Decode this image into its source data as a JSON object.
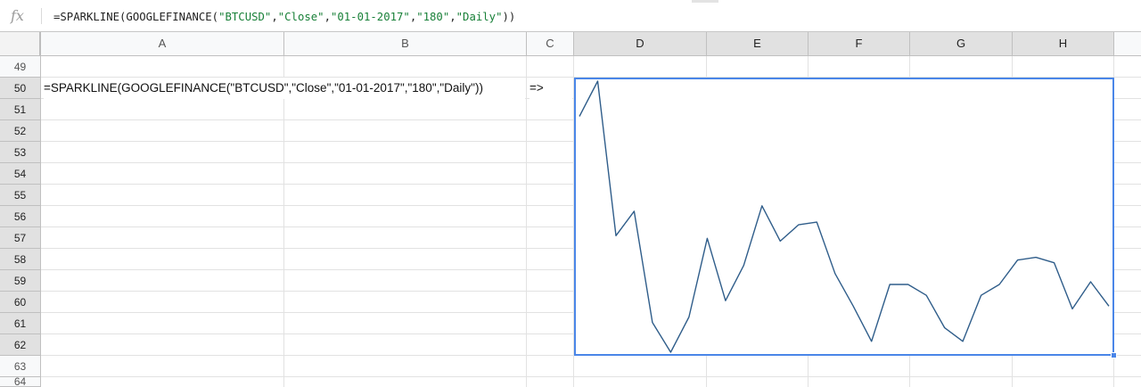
{
  "formula_bar": {
    "icon": "fx-icon",
    "parts": {
      "p1": "=SPARKLINE(GOOGLEFINANCE(",
      "s1": "\"BTCUSD\"",
      "c1": ",",
      "s2": "\"Close\"",
      "c2": ",",
      "s3": "\"01-01-2017\"",
      "c3": ",",
      "s4": "\"180\"",
      "c4": ",",
      "s5": "\"Daily\"",
      "p2": "))"
    }
  },
  "columns": [
    "A",
    "B",
    "C",
    "D",
    "E",
    "F",
    "G",
    "H"
  ],
  "selected_columns": [
    "D",
    "E",
    "F",
    "G",
    "H"
  ],
  "rows": [
    "49",
    "50",
    "51",
    "52",
    "53",
    "54",
    "55",
    "56",
    "57",
    "58",
    "59",
    "60",
    "61",
    "62",
    "63",
    "64"
  ],
  "selected_rows": [
    "50",
    "51",
    "52",
    "53",
    "54",
    "55",
    "56",
    "57",
    "58",
    "59",
    "60",
    "61",
    "62"
  ],
  "cells": {
    "A50": "=SPARKLINE(GOOGLEFINANCE(\"BTCUSD\",\"Close\",\"01-01-2017\",\"180\",\"Daily\"))",
    "C50": "=>"
  },
  "chart_data": {
    "type": "line",
    "x": [
      1,
      2,
      3,
      4,
      5,
      6,
      7,
      8,
      9,
      10,
      11,
      12,
      13,
      14,
      15,
      16,
      17,
      18,
      19,
      20,
      21,
      22,
      23,
      24,
      25,
      26,
      27,
      28,
      29,
      30
    ],
    "values": [
      0.87,
      1.0,
      0.43,
      0.52,
      0.11,
      0.0,
      0.13,
      0.42,
      0.19,
      0.32,
      0.54,
      0.41,
      0.47,
      0.48,
      0.29,
      0.17,
      0.04,
      0.25,
      0.25,
      0.21,
      0.09,
      0.04,
      0.21,
      0.25,
      0.34,
      0.35,
      0.33,
      0.16,
      0.26,
      0.17
    ],
    "series_color": "#2f5d8a",
    "title": "",
    "xlabel": "",
    "ylabel": ""
  },
  "colors": {
    "selection": "#4a86e8",
    "formula_string": "#188038"
  }
}
